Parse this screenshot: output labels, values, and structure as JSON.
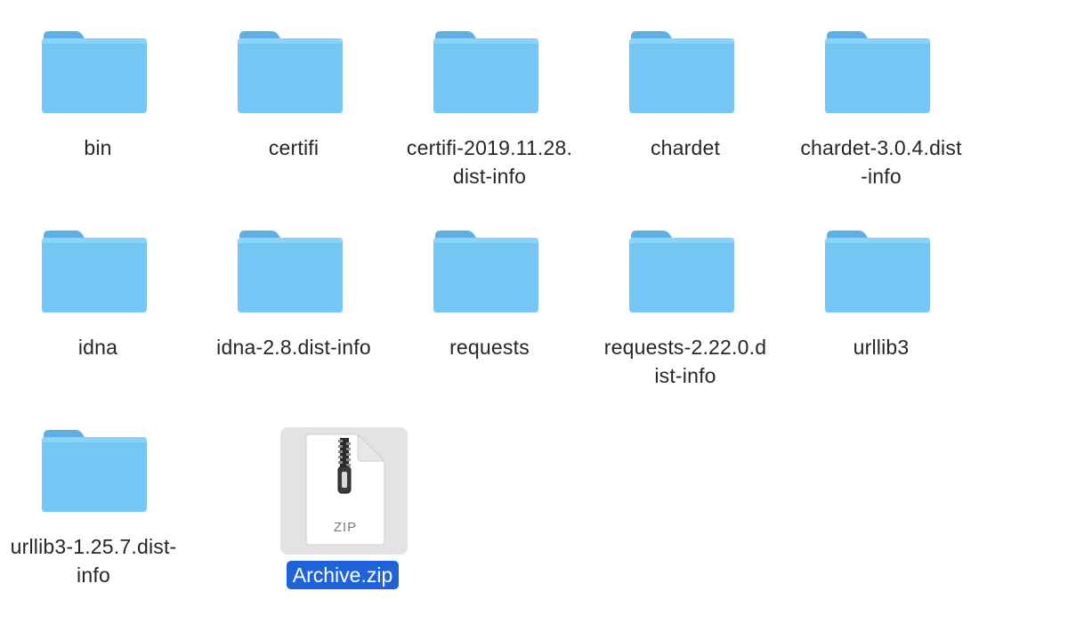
{
  "folders": [
    {
      "lines": [
        "bin"
      ]
    },
    {
      "lines": [
        "certifi"
      ]
    },
    {
      "lines": [
        "certifi-2019.11.28.",
        "dist-info"
      ]
    },
    {
      "lines": [
        "chardet"
      ]
    },
    {
      "lines": [
        "chardet-3.0.4.dist",
        "-info"
      ]
    },
    {
      "lines": [
        "idna"
      ]
    },
    {
      "lines": [
        "idna-2.8.dist-info"
      ]
    },
    {
      "lines": [
        "requests"
      ]
    },
    {
      "lines": [
        "requests-2.22.0.d",
        "ist-info"
      ]
    },
    {
      "lines": [
        "urllib3"
      ]
    },
    {
      "lines": [
        "urllib3-1.25.7.dist-",
        "info"
      ]
    }
  ],
  "archive": {
    "name": "Archive.zip",
    "badge": "ZIP",
    "selected": true
  },
  "colors": {
    "folder_body": "#74c6f4",
    "folder_tab": "#5cb0e6",
    "selection": "#1e63d9",
    "icon": "folder-icon"
  }
}
